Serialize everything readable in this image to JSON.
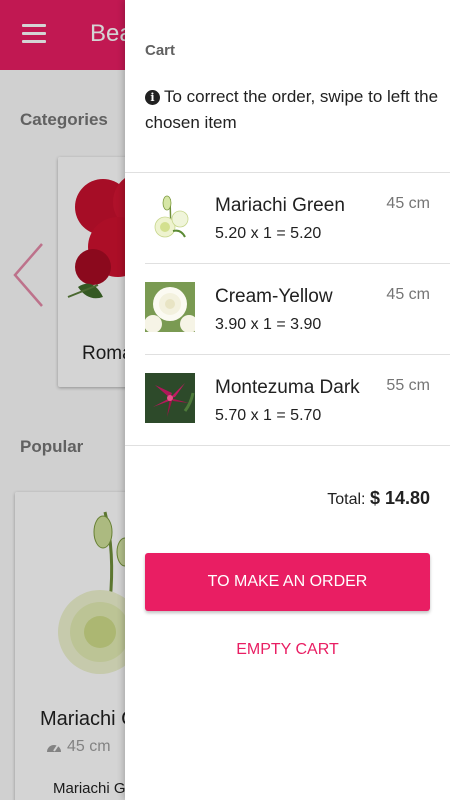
{
  "app": {
    "title": "Beauty Flowers",
    "categories_label": "Categories",
    "popular_label": "Popular",
    "category_card": {
      "name": "Roman Carnation"
    },
    "popular_card": {
      "name": "Mariachi Green",
      "size": "45 cm",
      "subtitle": "Mariachi Green"
    }
  },
  "cart": {
    "title": "Cart",
    "hint": "To correct the order, swipe to left the chosen item",
    "items": [
      {
        "name": "Mariachi Green",
        "size": "45 cm",
        "calc": "5.20 x 1 = 5.20",
        "thumb": "white-green-lisianthus"
      },
      {
        "name": "Cream-Yellow",
        "size": "45 cm",
        "calc": "3.90 x 1 = 3.90",
        "thumb": "cream-rose"
      },
      {
        "name": "Montezuma Dark",
        "size": "55 cm",
        "calc": "5.70 x 1 = 5.70",
        "thumb": "pink-lily"
      }
    ],
    "total_label": "Total:",
    "total_value": "$ 14.80",
    "order_button": "To make an order",
    "empty_button": "Empty cart"
  },
  "colors": {
    "accent": "#e91e63",
    "scrim": "rgba(0,0,0,0.17)"
  },
  "icons": {
    "menu": "menu-icon",
    "info": "info-icon",
    "back": "chevron-left-icon",
    "size": "gauge-icon"
  }
}
